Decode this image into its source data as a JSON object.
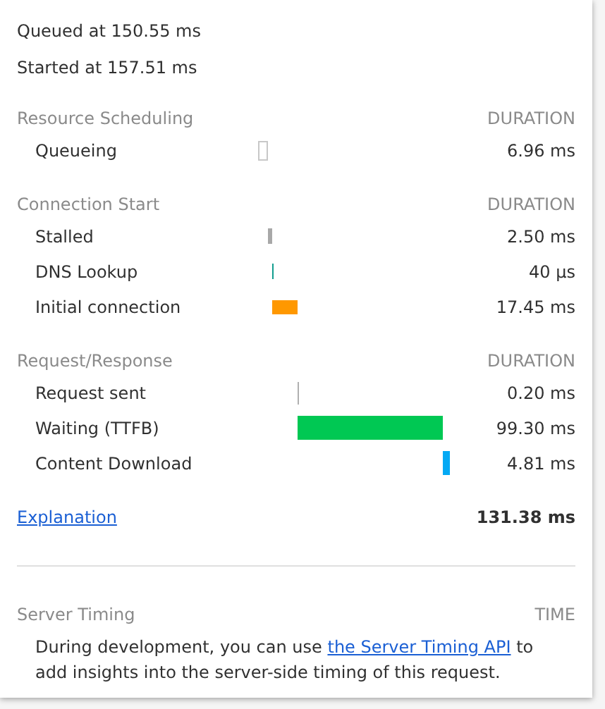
{
  "queued_at": "Queued at 150.55 ms",
  "started_at": "Started at 157.51 ms",
  "sections": [
    {
      "title": "Resource Scheduling",
      "column": "DURATION",
      "rows": [
        {
          "kind": "queueing",
          "label": "Queueing",
          "duration": "6.96 ms"
        }
      ]
    },
    {
      "title": "Connection Start",
      "column": "DURATION",
      "rows": [
        {
          "kind": "stalled",
          "label": "Stalled",
          "duration": "2.50 ms"
        },
        {
          "kind": "dns",
          "label": "DNS Lookup",
          "duration": "40 µs"
        },
        {
          "kind": "connection",
          "label": "Initial connection",
          "duration": "17.45 ms"
        }
      ]
    },
    {
      "title": "Request/Response",
      "column": "DURATION",
      "rows": [
        {
          "kind": "request",
          "label": "Request sent",
          "duration": "0.20 ms"
        },
        {
          "kind": "waiting",
          "label": "Waiting (TTFB)",
          "duration": "99.30 ms"
        },
        {
          "kind": "download",
          "label": "Content Download",
          "duration": "4.81 ms"
        }
      ]
    }
  ],
  "explanation_link": "Explanation",
  "total": "131.38 ms",
  "server_timing": {
    "title": "Server Timing",
    "column": "TIME",
    "text_before": "During development, you can use ",
    "link": "the Server Timing API",
    "text_after": " to add insights into the server-side timing of this request."
  }
}
